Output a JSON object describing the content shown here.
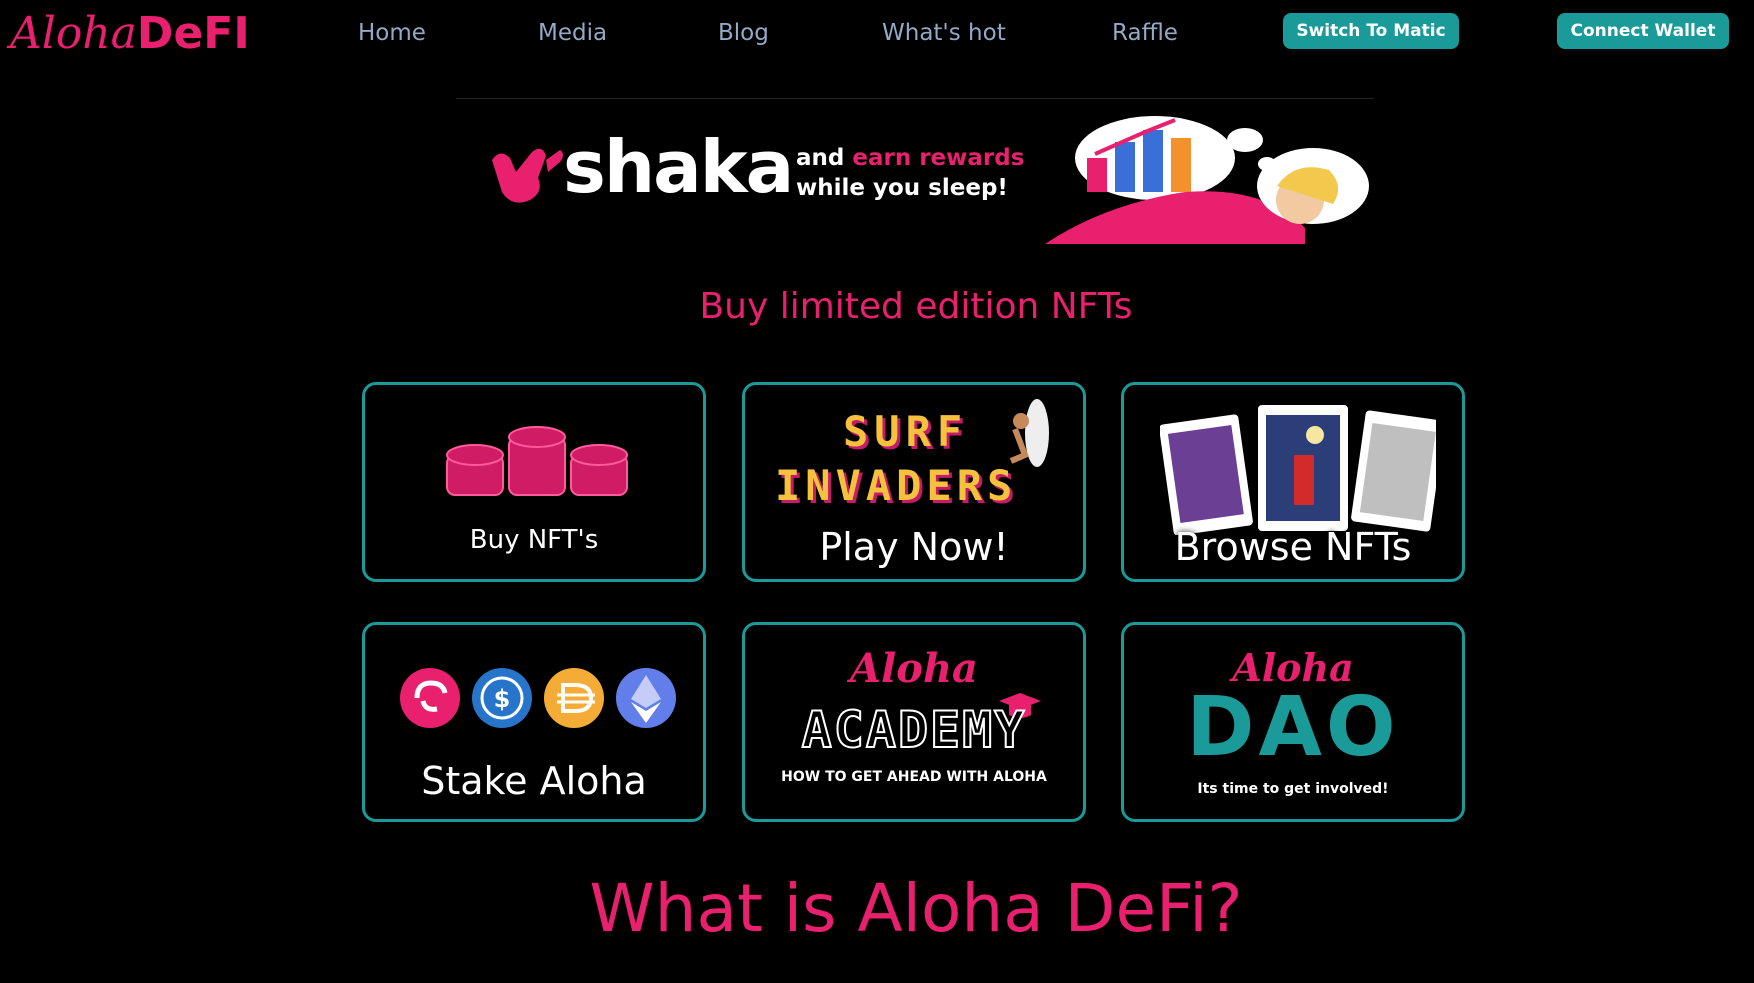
{
  "header": {
    "logo_script": "Aloha",
    "logo_bold": "DeFI",
    "nav": [
      "Home",
      "Media",
      "Blog",
      "What's hot",
      "Raffle"
    ],
    "switch_button": "Switch To Matic",
    "connect_button": "Connect Wallet"
  },
  "banner": {
    "brand": "shaka",
    "line1_prefix": "and",
    "line1_highlight": "earn rewards",
    "line2": "while you sleep!"
  },
  "section_title": "Buy limited edition NFTs",
  "cards": {
    "buy_nfts": "Buy NFT's",
    "surf_title_1": "SURF",
    "surf_title_2": "INVADERS",
    "play_now": "Play Now!",
    "browse_nfts": "Browse NFTs",
    "stake_aloha": "Stake Aloha",
    "academy_script": "Aloha",
    "academy_title": "ACADEMY",
    "academy_sub": "HOW TO GET AHEAD WITH ALOHA",
    "dao_script": "Aloha",
    "dao_title": "DAO",
    "dao_sub": "Its time to get involved!"
  },
  "about_title": "What is Aloha DeFi?",
  "colors": {
    "brand_pink": "#e8206e",
    "teal": "#1a9a98",
    "nav_text": "#93a9c6"
  }
}
